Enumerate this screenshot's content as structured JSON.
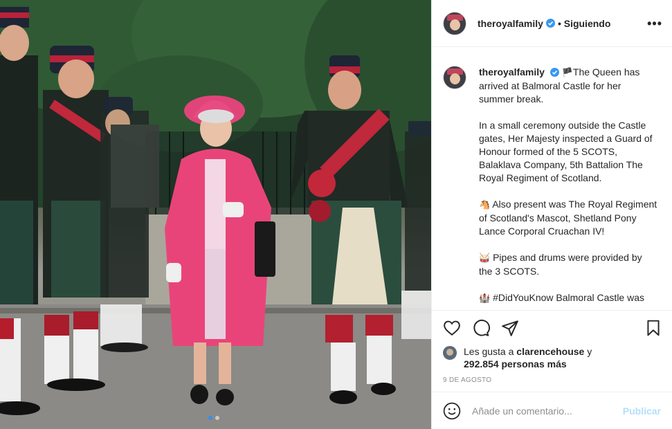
{
  "post": {
    "username": "theroyalfamily",
    "follow_state": "• Siguiendo",
    "verified_icon": "verified-badge-icon",
    "more_icon": "ellipsis-icon"
  },
  "caption": {
    "username": "theroyalfamily",
    "flag_emoji": "🏴",
    "p1": "The Queen has arrived at Balmoral Castle for her summer break.",
    "p2": "In a small ceremony outside the Castle gates, Her Majesty inspected a Guard of Honour formed of the 5 SCOTS, Balaklava Company, 5th Battalion The Royal Regiment of Scotland.",
    "horse_emoji": "🐴",
    "p3": "Also present was The Royal Regiment of Scotland's Mascot, Shetland Pony Lance Corporal Cruachan IV!",
    "drum_emoji": "🥁",
    "p4": "Pipes and drums were provided by the 3 SCOTS.",
    "castle_emoji": "🏰",
    "p5": "#DidYouKnow Balmoral Castle was"
  },
  "likes": {
    "prefix": "Les gusta a ",
    "user": "clarencehouse",
    "suffix": " y",
    "count": "292.854 personas más"
  },
  "date": "9 DE AGOSTO",
  "comment": {
    "placeholder": "Añade un comentario...",
    "post_label": "Publicar"
  },
  "carousel": {
    "slides": 2,
    "active": 1
  },
  "colors": {
    "accent": "#0095f6",
    "post_disabled": "#b2dffc",
    "muted": "#8e8e8e",
    "coat_pink": "#e9447a"
  },
  "icons": [
    "heart-icon",
    "comment-icon",
    "share-icon",
    "bookmark-icon",
    "emoji-icon"
  ]
}
